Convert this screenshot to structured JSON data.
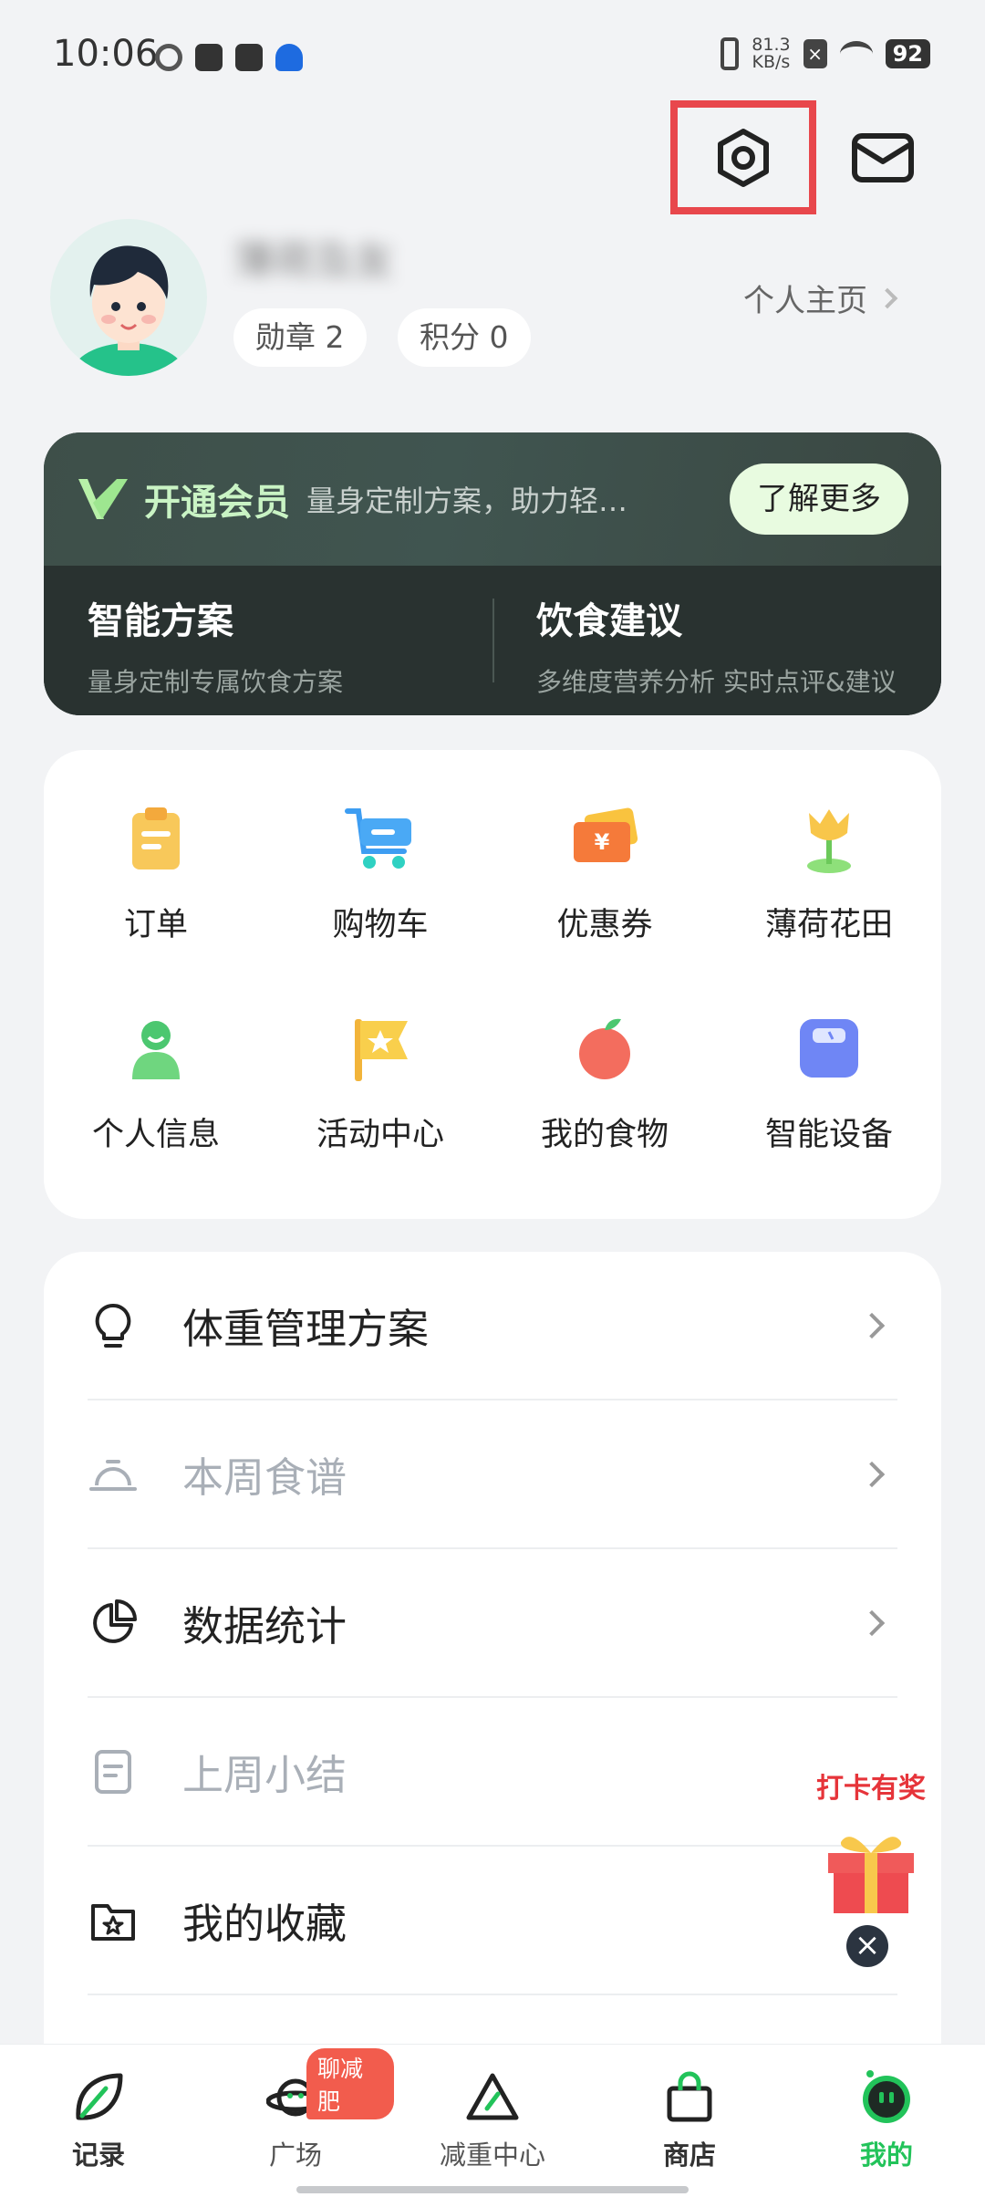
{
  "status_bar": {
    "time": "10:06",
    "net_speed_value": "81.3",
    "net_speed_unit": "KB/s",
    "battery": "92"
  },
  "profile": {
    "username": "薄荷及友",
    "medals_label": "勋章 2",
    "points_label": "积分 0",
    "home_link": "个人主页"
  },
  "vip": {
    "title": "开通会员",
    "desc": "量身定制方案，助力轻…",
    "button": "了解更多",
    "features": [
      {
        "title": "智能方案",
        "sub": "量身定制专属饮食方案"
      },
      {
        "title": "饮食建议",
        "sub": "多维度营养分析 实时点评&建议"
      }
    ]
  },
  "grid": [
    {
      "label": "订单",
      "icon": "clipboard-icon",
      "color": "#f6c24c"
    },
    {
      "label": "购物车",
      "icon": "cart-icon",
      "color": "#3d9df2"
    },
    {
      "label": "优惠券",
      "icon": "coupon-icon",
      "color": "#f57a3a"
    },
    {
      "label": "薄荷花田",
      "icon": "tulip-icon",
      "color": "#f8c64a"
    },
    {
      "label": "个人信息",
      "icon": "person-icon",
      "color": "#4cc770"
    },
    {
      "label": "活动中心",
      "icon": "flag-icon",
      "color": "#f6c54a"
    },
    {
      "label": "我的食物",
      "icon": "apple-icon",
      "color": "#f36d5e"
    },
    {
      "label": "智能设备",
      "icon": "scale-icon",
      "color": "#6f86f5"
    }
  ],
  "list": [
    {
      "label": "体重管理方案",
      "icon": "lightbulb-icon",
      "dim": false
    },
    {
      "label": "本周食谱",
      "icon": "dish-cover-icon",
      "dim": true
    },
    {
      "label": "数据统计",
      "icon": "pie-chart-icon",
      "dim": false
    },
    {
      "label": "上周小结",
      "icon": "document-icon",
      "dim": true
    },
    {
      "label": "我的收藏",
      "icon": "star-folder-icon",
      "dim": false
    }
  ],
  "reward": {
    "text": "打卡有奖"
  },
  "nav": [
    {
      "label": "记录",
      "icon": "leaf-icon"
    },
    {
      "label": "广场",
      "icon": "planet-icon",
      "badge": "聊减肥"
    },
    {
      "label": "减重中心",
      "icon": "triangle-icon"
    },
    {
      "label": "商店",
      "icon": "bag-icon"
    },
    {
      "label": "我的",
      "icon": "mint-face-icon"
    }
  ],
  "colors": {
    "accent": "#22c35a",
    "highlight_box": "#e8474c"
  }
}
